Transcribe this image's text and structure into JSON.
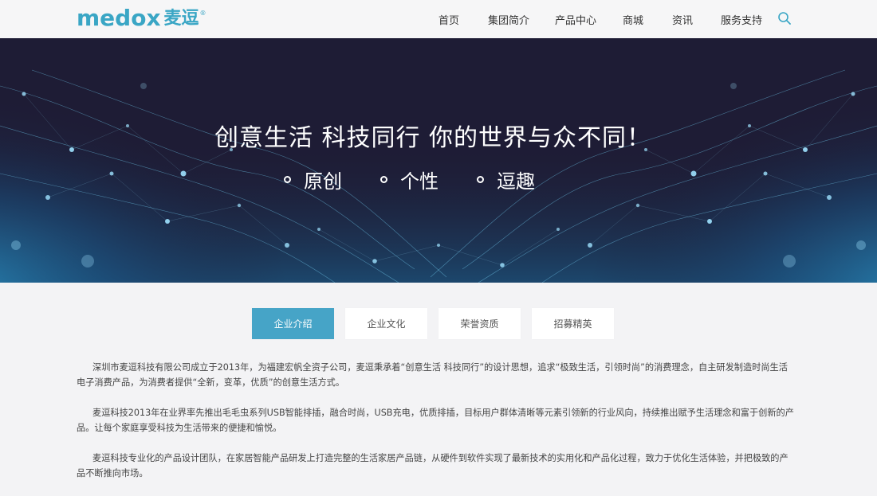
{
  "header": {
    "logo_text": "medox",
    "logo_cn": "麦逗",
    "logo_reg": "®",
    "nav": [
      "首页",
      "集团简介",
      "产品中心",
      "商城",
      "资讯",
      "服务支持"
    ]
  },
  "banner": {
    "title": "创意生活 科技同行 你的世界与众不同！",
    "features": [
      "原创",
      "个性",
      "逗趣"
    ]
  },
  "tabs": {
    "items": [
      "企业介绍",
      "企业文化",
      "荣誉资质",
      "招募精英"
    ],
    "active": "企业介绍"
  },
  "content": {
    "paragraphs": [
      "深圳市麦逗科技有限公司成立于2013年，为福建宏帆全资子公司，麦逗秉承着“创意生活 科技同行”的设计思想，追求“极致生活，引领时尚”的消费理念，自主研发制造时尚生活电子消费产品，为消费者提供“全新，变革，优质”的创意生活方式。",
      "麦逗科技2013年在业界率先推出毛毛虫系列USB智能排插，融合时尚，USB充电，优质排插，目标用户群体清晰等元素引领新的行业风向，持续推出赋予生活理念和富于创新的产品。让每个家庭享受科技为生活带来的便捷和愉悦。",
      "麦逗科技专业化的产品设计团队，在家居智能产品研发上打造完整的生活家居产品链，从硬件到软件实现了最新技术的实用化和产品化过程，致力于优化生活体验，并把极致的产品不断推向市场。"
    ]
  },
  "colors": {
    "accent": "#46a4c7",
    "logo": "#3aa6c5",
    "banner_bg": "#1c1a33"
  }
}
